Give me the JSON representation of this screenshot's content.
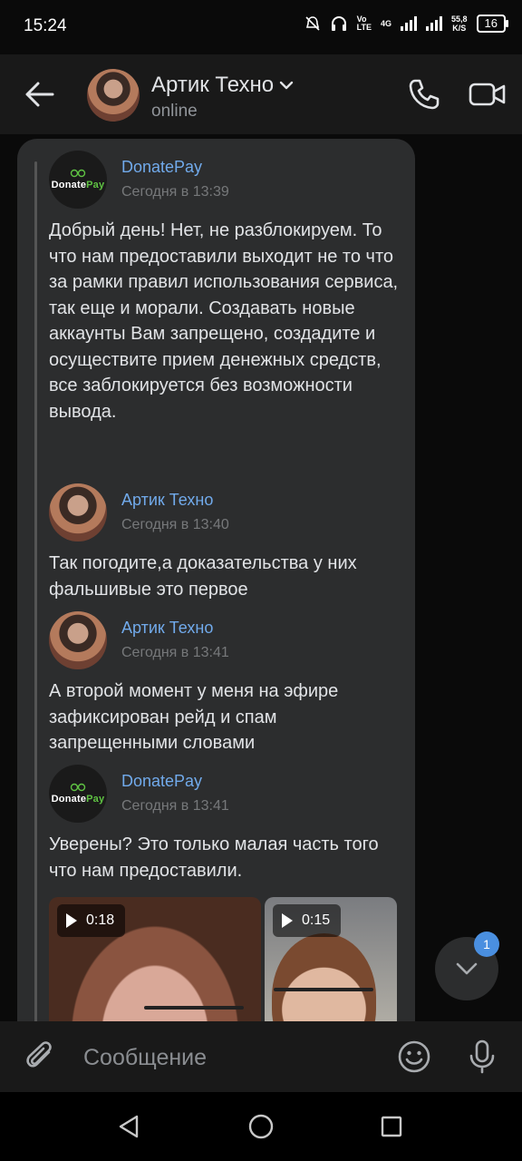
{
  "status_bar": {
    "time": "15:24",
    "volte_top": "Vo",
    "volte_bottom": "LTE",
    "network": "4G",
    "speed_value": "55,8",
    "speed_unit": "K/S",
    "battery": "16"
  },
  "header": {
    "contact_name": "Артик Техно",
    "status": "online"
  },
  "messages": [
    {
      "sender": "DonatePay",
      "time": "Сегодня в 13:39",
      "text": "Добрый день! Нет, не разблокируем. То что нам предоставили выходит не то что за рамки правил использования сервиса, так еще и морали. Создавать новые аккаунты Вам запрещено, создадите и осуществите прием денежных средств, все заблокируется без возможности вывода."
    },
    {
      "sender": "Артик Техно",
      "time": "Сегодня в 13:40",
      "text": "Так погодите,а доказательства у них фальшивые это первое"
    },
    {
      "sender": "Артик Техно",
      "time": "Сегодня в 13:41",
      "text": "А второй момент у меня на эфире зафиксирован рейд и спам запрещенными словами"
    },
    {
      "sender": "DonatePay",
      "time": "Сегодня в 13:41",
      "text": "Уверены? Это только малая часть того что нам предоставили."
    }
  ],
  "donatepay_logo": {
    "part1": "Donate",
    "part2": "Pay"
  },
  "videos": [
    {
      "duration": "0:18"
    },
    {
      "duration": "0:15"
    }
  ],
  "scroll_down": {
    "unread_count": "1"
  },
  "composer": {
    "placeholder": "Сообщение"
  },
  "colors": {
    "accent_link": "#71aaeb",
    "bubble_bg": "#2c2d2e",
    "badge_blue": "#4a8fe0",
    "donatepay_green": "#5fc243"
  },
  "icons": {
    "back": "arrow-left-icon",
    "call": "phone-icon",
    "video_call": "video-camera-icon",
    "attach": "paperclip-icon",
    "emoji": "smile-icon",
    "mic": "microphone-icon",
    "scroll": "chevron-down-icon"
  }
}
